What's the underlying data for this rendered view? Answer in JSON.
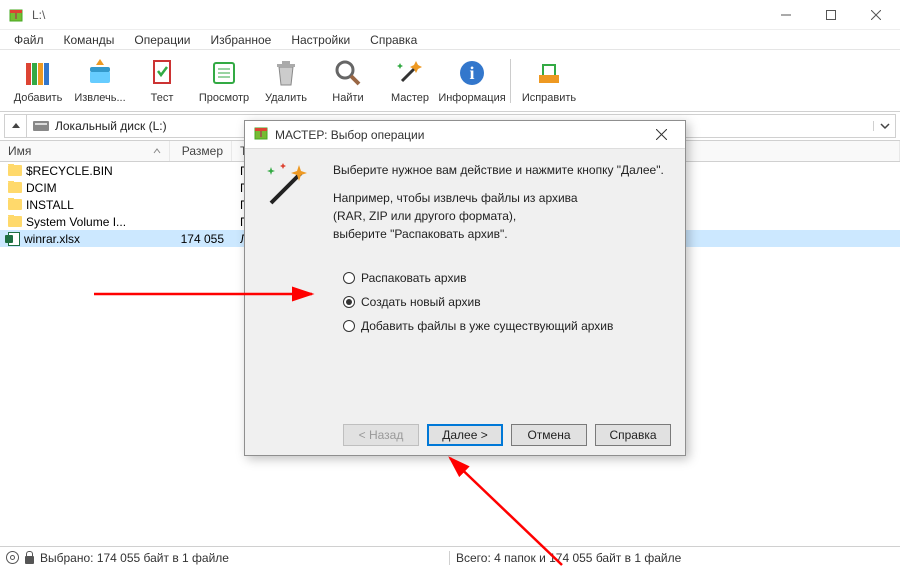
{
  "window": {
    "title": "L:\\"
  },
  "menu": {
    "items": [
      "Файл",
      "Команды",
      "Операции",
      "Избранное",
      "Настройки",
      "Справка"
    ]
  },
  "toolbar": {
    "buttons": [
      {
        "name": "add",
        "label": "Добавить"
      },
      {
        "name": "extract",
        "label": "Извлечь..."
      },
      {
        "name": "test",
        "label": "Тест"
      },
      {
        "name": "view",
        "label": "Просмотр"
      },
      {
        "name": "delete",
        "label": "Удалить"
      },
      {
        "name": "find",
        "label": "Найти"
      },
      {
        "name": "wizard",
        "label": "Мастер"
      },
      {
        "name": "info",
        "label": "Информация"
      },
      {
        "name": "repair",
        "label": "Исправить"
      }
    ]
  },
  "address": {
    "text": "Локальный диск (L:)"
  },
  "columns": {
    "name": "Имя",
    "size": "Размер",
    "type": "Тип"
  },
  "files": [
    {
      "name": "$RECYCLE.BIN",
      "size": "",
      "type": "Пап",
      "kind": "folder"
    },
    {
      "name": "DCIM",
      "size": "",
      "type": "Пап",
      "kind": "folder"
    },
    {
      "name": "INSTALL",
      "size": "",
      "type": "Пап",
      "kind": "folder"
    },
    {
      "name": "System Volume I...",
      "size": "",
      "type": "Пап",
      "kind": "folder"
    },
    {
      "name": "winrar.xlsx",
      "size": "174 055",
      "type": "Лис",
      "kind": "xlsx",
      "selected": true
    }
  ],
  "status": {
    "left": "Выбрано: 174 055 байт в 1 файле",
    "right": "Всего: 4 папок и 174 055 байт в 1 файле"
  },
  "dialog": {
    "title": "МАСТЕР:  Выбор операции",
    "line1": "Выберите нужное вам действие и нажмите кнопку \"Далее\".",
    "line2a": "Например, чтобы извлечь файлы из архива",
    "line2b": "(RAR, ZIP или другого формата),",
    "line2c": "выберите \"Распаковать архив\".",
    "options": [
      {
        "label": "Распаковать архив",
        "checked": false
      },
      {
        "label": "Создать новый архив",
        "checked": true
      },
      {
        "label": "Добавить файлы в уже существующий архив",
        "checked": false
      }
    ],
    "buttons": {
      "back": "< Назад",
      "next": "Далее >",
      "cancel": "Отмена",
      "help": "Справка"
    }
  }
}
